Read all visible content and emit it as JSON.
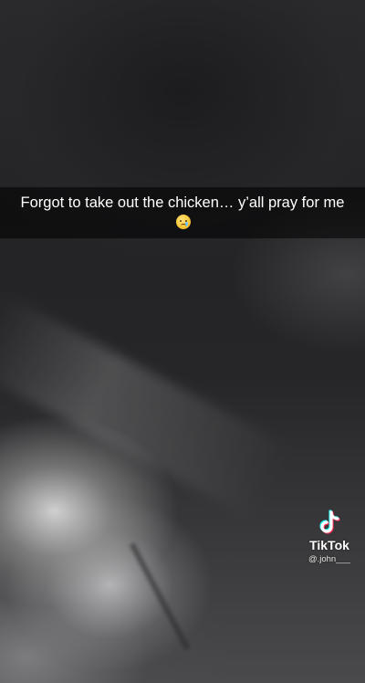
{
  "caption": {
    "text": "Forgot to take out the chicken… y’all pray for me",
    "emoji": "crying-face-emoji"
  },
  "watermark": {
    "brand": "TikTok",
    "handle": "@.john___",
    "logo_icon": "tiktok-logo-icon"
  },
  "colors": {
    "caption_bar": "#000000",
    "text": "#ffffff",
    "tiktok_cyan": "#25F4EE",
    "tiktok_red": "#FE2C55"
  }
}
